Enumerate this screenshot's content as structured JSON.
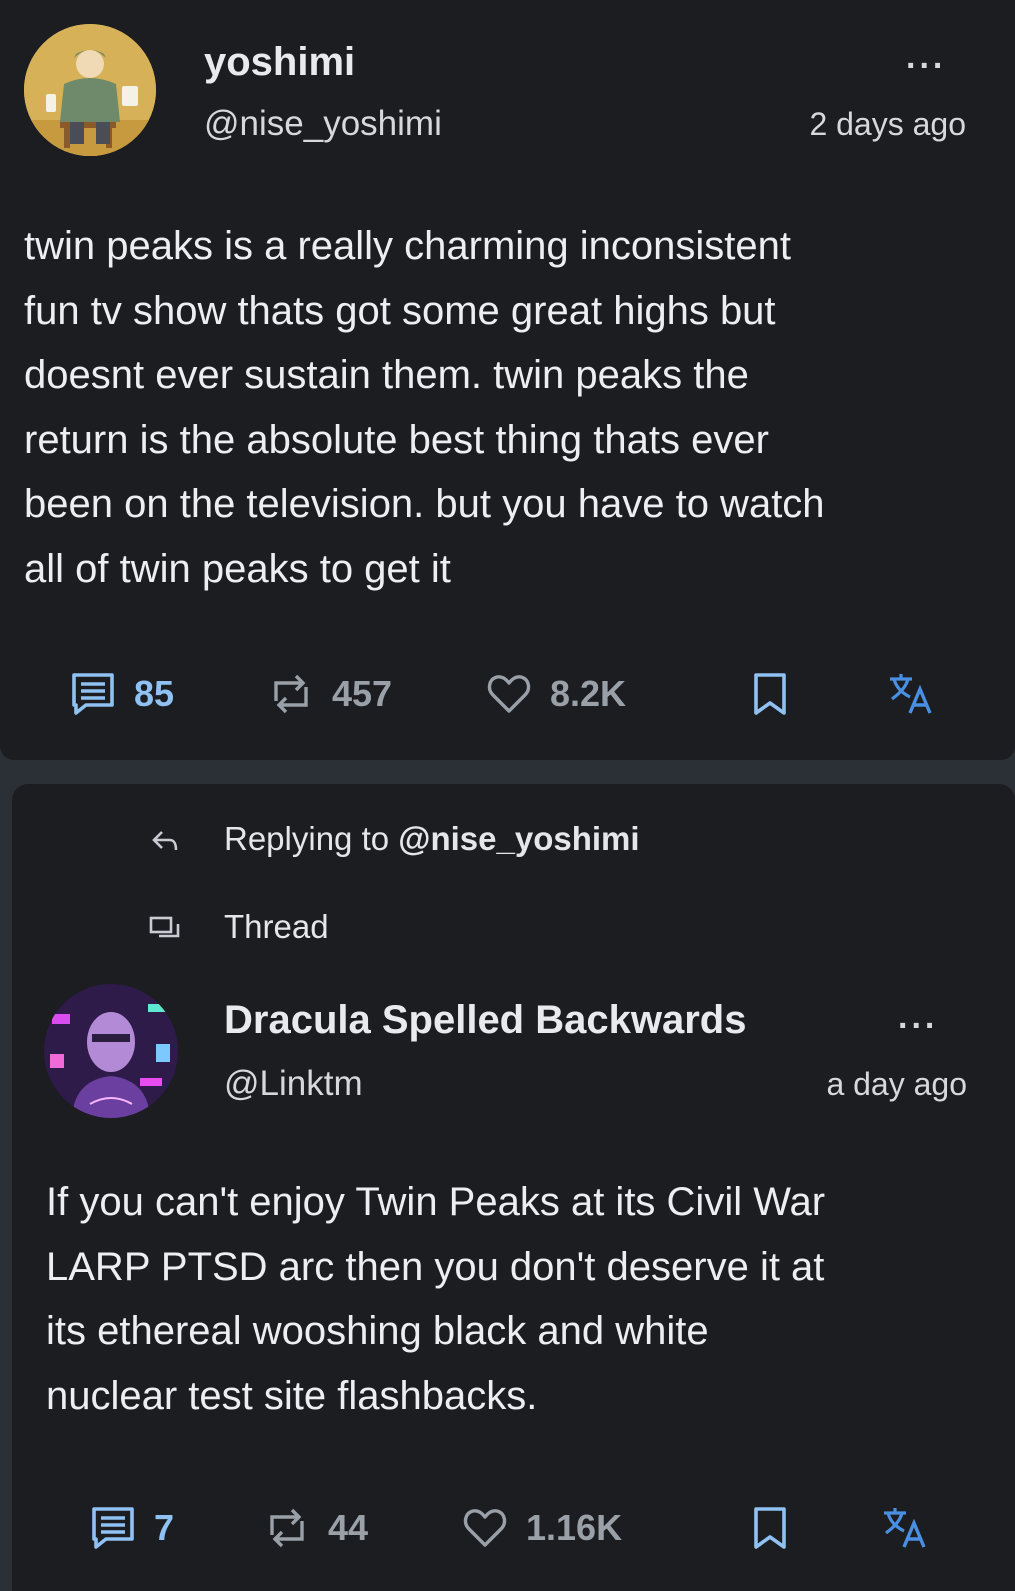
{
  "post1": {
    "author_name": "yoshimi",
    "author_handle": "@nise_yoshimi",
    "timestamp": "2 days ago",
    "more_label": "...",
    "body": "twin peaks is a really charming inconsistent fun tv show thats got some great highs but doesnt ever sustain them. twin peaks the return is the absolute best thing thats ever been on the television. but you have to watch all of twin peaks to get it",
    "body_lines": [
      "twin peaks is a really charming inconsistent",
      "fun tv show thats got some great highs but",
      "doesnt ever sustain them. twin peaks the",
      "return is the absolute best thing thats ever",
      "been on the television. but you have to watch",
      "all of twin peaks to get it"
    ],
    "replies": "85",
    "reposts": "457",
    "likes": "8.2K"
  },
  "post2": {
    "replying_prefix": "Replying to",
    "replying_to": "@nise_yoshimi",
    "thread_label": "Thread",
    "author_name": "Dracula Spelled Backwards",
    "author_handle": "@Linktm",
    "timestamp": "a day ago",
    "more_label": "...",
    "body_lines": [
      "If you can't enjoy Twin Peaks at its Civil War",
      "LARP PTSD arc then you don't deserve it at",
      "its ethereal wooshing black and white",
      "nuclear test site flashbacks."
    ],
    "replies": "7",
    "reposts": "44",
    "likes": "1.16K"
  },
  "colors": {
    "background": "#2b2f36",
    "card": "#1c1d21",
    "accent": "#8fc1f2",
    "translate": "#4a90e2",
    "muted": "#9aa0a8"
  },
  "icons": [
    "comment-icon",
    "repost-icon",
    "heart-icon",
    "bookmark-icon",
    "translate-icon",
    "reply-arrow-icon",
    "thread-icon",
    "more-icon"
  ]
}
